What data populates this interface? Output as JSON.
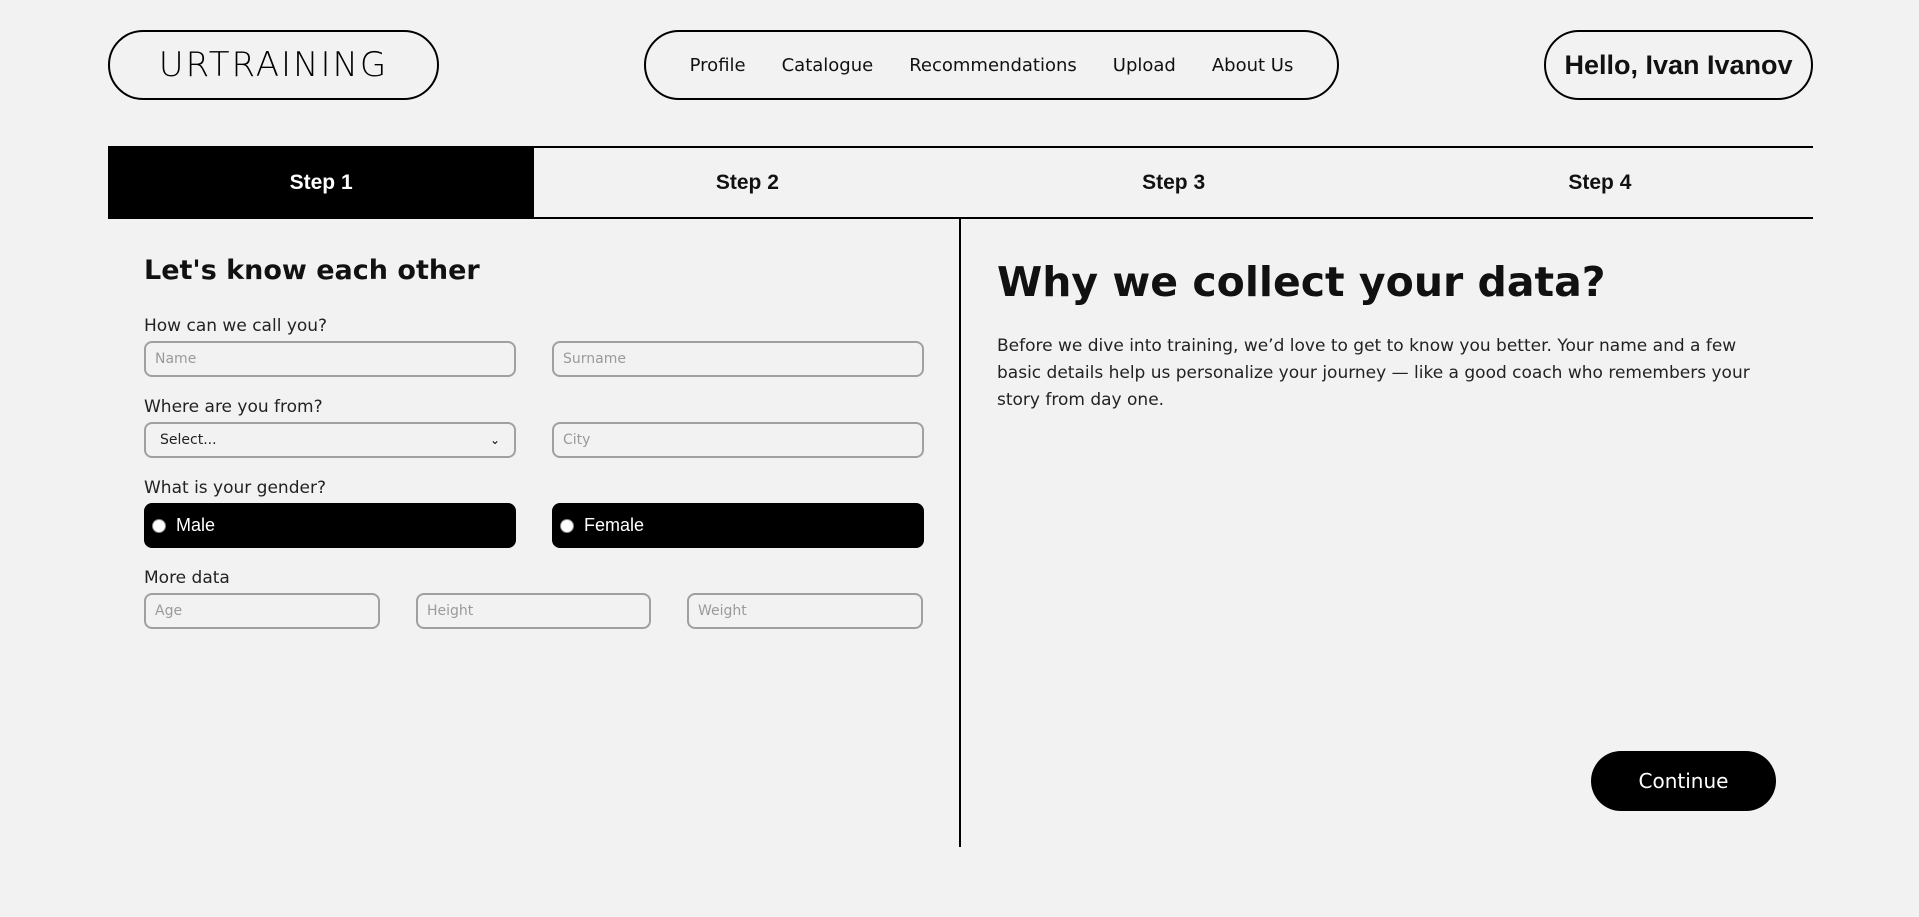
{
  "header": {
    "logo": "URTRAINING",
    "nav": [
      "Profile",
      "Catalogue",
      "Recommendations",
      "Upload",
      "About Us"
    ],
    "user_greeting": "Hello, Ivan Ivanov"
  },
  "steps": [
    "Step 1",
    "Step 2",
    "Step 3",
    "Step 4"
  ],
  "active_step": "Step 1",
  "form": {
    "title": "Let's know each other",
    "name_label": "How can we call you?",
    "name_placeholder": "Name",
    "surname_placeholder": "Surname",
    "location_label": "Where are you from?",
    "country_value": "Select...",
    "city_placeholder": "City",
    "gender_label": "What is your gender?",
    "gender_male": "Male",
    "gender_female": "Female",
    "more_label": "More data",
    "age_placeholder": "Age",
    "height_placeholder": "Height",
    "weight_placeholder": "Weight"
  },
  "info": {
    "title": "Why we collect your data?",
    "text": "Before we dive into training, we’d love to get to know you better. Your name and a few basic details help us personalize your journey — like a good coach who remembers your story from day one."
  },
  "continue_label": "Continue",
  "colors": {
    "background": "#f2f2f2",
    "accent": "#000000",
    "input_border": "#a0a0a0"
  }
}
